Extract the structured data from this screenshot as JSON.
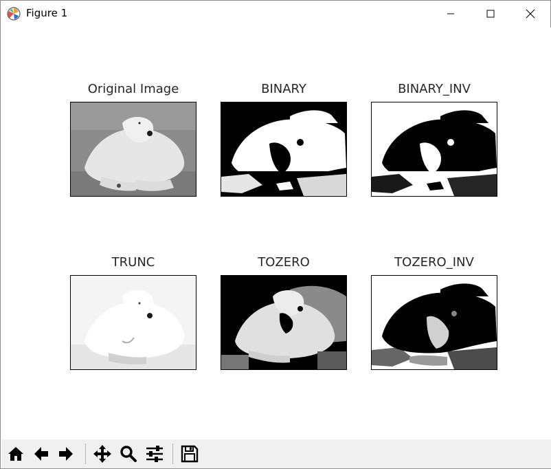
{
  "window": {
    "title": "Figure 1"
  },
  "figure": {
    "panels": [
      {
        "title": "Original Image",
        "variant": "original"
      },
      {
        "title": "BINARY",
        "variant": "binary"
      },
      {
        "title": "BINARY_INV",
        "variant": "binary_inv"
      },
      {
        "title": "TRUNC",
        "variant": "trunc"
      },
      {
        "title": "TOZERO",
        "variant": "tozero"
      },
      {
        "title": "TOZERO_INV",
        "variant": "tozero_inv"
      }
    ]
  },
  "toolbar": {
    "buttons": [
      {
        "name": "home-button",
        "icon": "home-icon"
      },
      {
        "name": "back-button",
        "icon": "arrow-left-icon"
      },
      {
        "name": "forward-button",
        "icon": "arrow-right-icon"
      },
      {
        "name": "pan-button",
        "icon": "move-icon"
      },
      {
        "name": "zoom-button",
        "icon": "magnifier-icon"
      },
      {
        "name": "configure-subplots-button",
        "icon": "sliders-icon"
      },
      {
        "name": "save-button",
        "icon": "floppy-disk-icon"
      }
    ]
  }
}
